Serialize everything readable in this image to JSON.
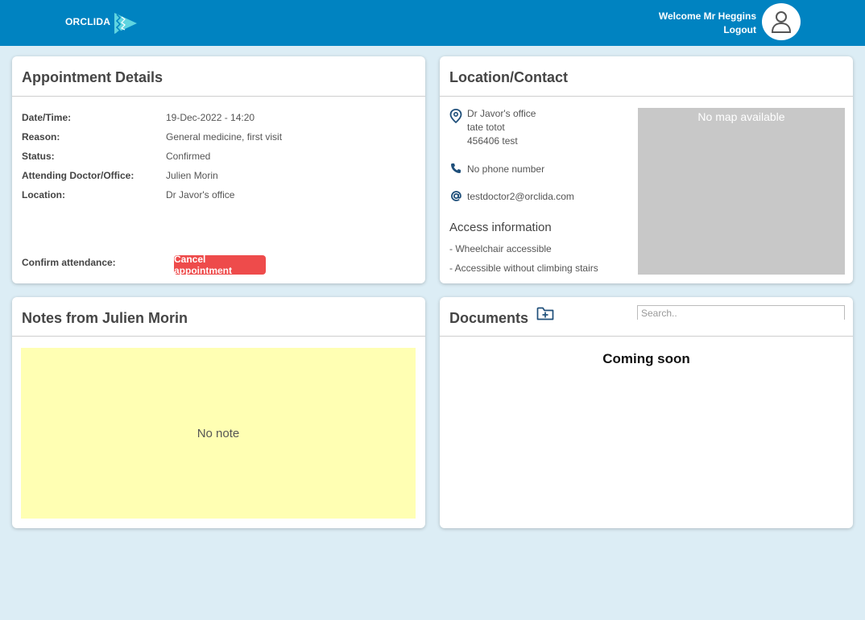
{
  "header": {
    "brand": "ORCLIDA",
    "welcome": "Welcome Mr Heggins",
    "logout": "Logout"
  },
  "appointment": {
    "title": "Appointment Details",
    "rows": [
      {
        "label": "Date/Time:",
        "value": "19-Dec-2022 - 14:20"
      },
      {
        "label": "Reason:",
        "value": "General medicine, first visit"
      },
      {
        "label": "Status:",
        "value": "Confirmed"
      },
      {
        "label": "Attending Doctor/Office:",
        "value": "Julien Morin"
      },
      {
        "label": "Location:",
        "value": "Dr Javor's office"
      }
    ],
    "confirm_label": "Confirm attendance:",
    "cancel_button": "Cancel appointment"
  },
  "location": {
    "title": "Location/Contact",
    "address": [
      "Dr Javor's office",
      "tate totot",
      "456406 test"
    ],
    "phone": "No phone number",
    "email": "testdoctor2@orclida.com",
    "access_heading": "Access information",
    "access_items": [
      "- Wheelchair accessible",
      "- Accessible without climbing stairs"
    ],
    "map_text": "No map available"
  },
  "notes": {
    "title": "Notes from Julien Morin",
    "content": "No note"
  },
  "documents": {
    "title": "Documents",
    "search_placeholder": "Search..",
    "coming_soon": "Coming soon"
  },
  "colors": {
    "header": "#0083c1",
    "background": "#dcedf5",
    "cancel": "#ee4b4b",
    "note": "#ffffb3",
    "icon": "#1f4f7a"
  }
}
